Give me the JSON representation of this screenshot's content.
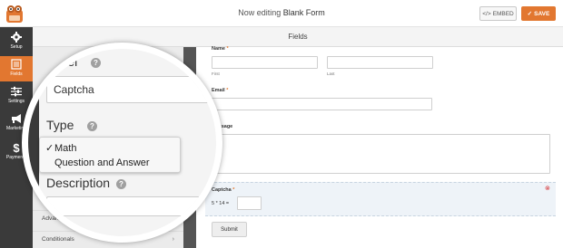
{
  "header": {
    "editing_prefix": "Now editing",
    "form_name": "Blank Form",
    "embed_label": "EMBED",
    "save_label": "SAVE",
    "accent_color": "#e27730"
  },
  "sidebar": {
    "items": [
      {
        "label": "Setup",
        "icon": "gear-icon"
      },
      {
        "label": "Fields",
        "icon": "fields-list-icon",
        "active": true
      },
      {
        "label": "Settings",
        "icon": "sliders-icon"
      },
      {
        "label": "Marketing",
        "icon": "megaphone-icon"
      },
      {
        "label": "Payments",
        "icon": "dollar-icon"
      }
    ]
  },
  "fields_header": "Fields",
  "panel": {
    "rows": [
      {
        "label": "Advanced Options"
      },
      {
        "label": "Conditionals"
      }
    ]
  },
  "magnifier": {
    "label_title": "Label",
    "label_value": "Captcha",
    "type_title": "Type",
    "type_options": [
      {
        "label": "Math",
        "selected": true
      },
      {
        "label": "Question and Answer",
        "selected": false
      }
    ],
    "description_title": "Description"
  },
  "preview": {
    "name_label": "Name",
    "name_first": "First",
    "name_last": "Last",
    "email_label": "Email",
    "message_label": "Message",
    "captcha_label": "Captcha",
    "captcha_question": "5 * 14 =",
    "submit_label": "Submit",
    "required_mark": "*"
  }
}
